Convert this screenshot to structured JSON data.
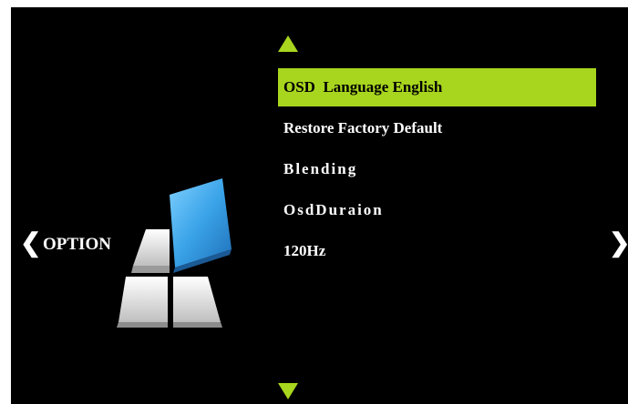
{
  "section": {
    "label": "OPTION",
    "nav_left_icon": "chevron-left-icon",
    "nav_right_icon": "chevron-right-icon"
  },
  "scroll": {
    "up_icon": "triangle-up-icon",
    "down_icon": "triangle-down-icon"
  },
  "menu": {
    "items": [
      {
        "label": "OSD  Language English",
        "selected": true
      },
      {
        "label": "Restore Factory Default",
        "selected": false
      },
      {
        "label": "Blending",
        "selected": false
      },
      {
        "label": "OsdDuraion",
        "selected": false
      },
      {
        "label": "120Hz",
        "selected": false
      }
    ]
  },
  "colors": {
    "background": "#000000",
    "accent": "#a8d61e",
    "text": "#ffffff",
    "logo_blue": "#3aa3e8"
  }
}
